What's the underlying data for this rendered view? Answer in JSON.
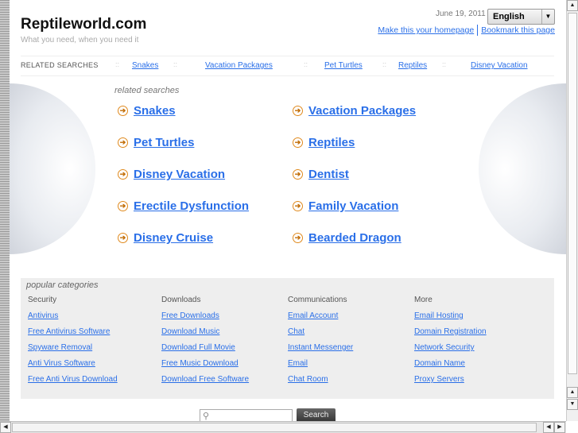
{
  "header": {
    "title": "Reptileworld.com",
    "tagline": "What you need, when you need it",
    "date": "June 19, 2011",
    "language": "English",
    "homepage_link": "Make this your homepage",
    "bookmark_link": "Bookmark this page"
  },
  "related_bar": {
    "label": "RELATED SEARCHES",
    "links": [
      "Snakes",
      "Vacation Packages",
      "Pet Turtles",
      "Reptiles",
      "Disney Vacation"
    ]
  },
  "related": {
    "heading": "related searches",
    "items": [
      "Snakes",
      "Vacation Packages",
      "Pet Turtles",
      "Reptiles",
      "Disney Vacation",
      "Dentist",
      "Erectile Dysfunction",
      "Family Vacation",
      "Disney Cruise",
      "Bearded Dragon"
    ]
  },
  "popular": {
    "heading": "popular categories",
    "columns": [
      {
        "title": "Security",
        "links": [
          "Antivirus",
          "Free Antivirus Software",
          "Spyware Removal",
          "Anti Virus Software",
          "Free Anti Virus Download"
        ]
      },
      {
        "title": "Downloads",
        "links": [
          "Free Downloads",
          "Download Music",
          "Download Full Movie",
          "Free Music Download",
          "Download Free Software"
        ]
      },
      {
        "title": "Communications",
        "links": [
          "Email Account",
          "Chat",
          "Instant Messenger",
          "Email",
          "Chat Room"
        ]
      },
      {
        "title": "More",
        "links": [
          "Email Hosting",
          "Domain Registration",
          "Network Security",
          "Domain Name",
          "Proxy Servers"
        ]
      }
    ]
  },
  "search": {
    "button": "Search",
    "value": ""
  }
}
